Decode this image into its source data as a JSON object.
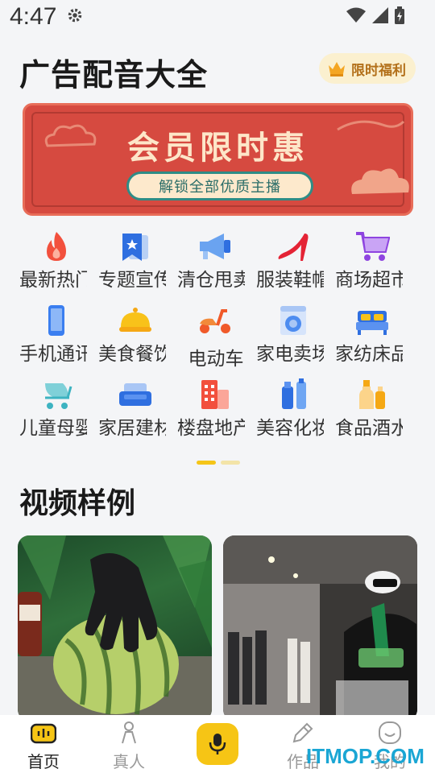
{
  "status_bar": {
    "time": "4:47",
    "icons": [
      "gear-icon",
      "wifi-icon",
      "signal-icon",
      "battery-icon"
    ]
  },
  "header": {
    "title": "广告配音大全",
    "benefit_label": "限时福利",
    "benefit_icon": "crown-icon"
  },
  "banner": {
    "title": "会员限时惠",
    "subtitle": "解锁全部优质主播"
  },
  "categories": [
    [
      {
        "label": "最新热门",
        "icon": "fire-icon"
      },
      {
        "label": "专题宣传",
        "icon": "star-bookmark-icon"
      },
      {
        "label": "清仓甩卖",
        "icon": "megaphone-icon"
      },
      {
        "label": "服装鞋帽",
        "icon": "high-heel-icon"
      },
      {
        "label": "商场超市",
        "icon": "shopping-cart-icon"
      }
    ],
    [
      {
        "label": "手机通讯",
        "icon": "phone-icon"
      },
      {
        "label": "美食餐饮",
        "icon": "food-cloche-icon"
      },
      {
        "label": "电动车",
        "icon": "scooter-icon"
      },
      {
        "label": "家电卖场",
        "icon": "washing-machine-icon"
      },
      {
        "label": "家纺床品",
        "icon": "bed-icon"
      }
    ],
    [
      {
        "label": "儿童母婴",
        "icon": "stroller-icon"
      },
      {
        "label": "家居建材",
        "icon": "sofa-icon"
      },
      {
        "label": "楼盘地产",
        "icon": "building-icon"
      },
      {
        "label": "美容化妆",
        "icon": "cosmetics-icon"
      },
      {
        "label": "食品酒水",
        "icon": "bottle-icon"
      }
    ]
  ],
  "pager": {
    "pages": 2,
    "active": 1
  },
  "videos": {
    "section_title": "视频样例"
  },
  "bottom_nav": [
    {
      "label": "首页",
      "icon": "home-icon",
      "active": true
    },
    {
      "label": "真人",
      "icon": "person-icon",
      "active": false
    },
    {
      "label": "",
      "icon": "microphone-icon",
      "active": false
    },
    {
      "label": "作品",
      "icon": "pen-icon",
      "active": false
    },
    {
      "label": "我的",
      "icon": "smile-icon",
      "active": false
    }
  ],
  "watermark": "ITMOP.COM",
  "colors": {
    "accent": "#f6c515",
    "banner": "#d64a40",
    "text": "#1a1a1a"
  }
}
